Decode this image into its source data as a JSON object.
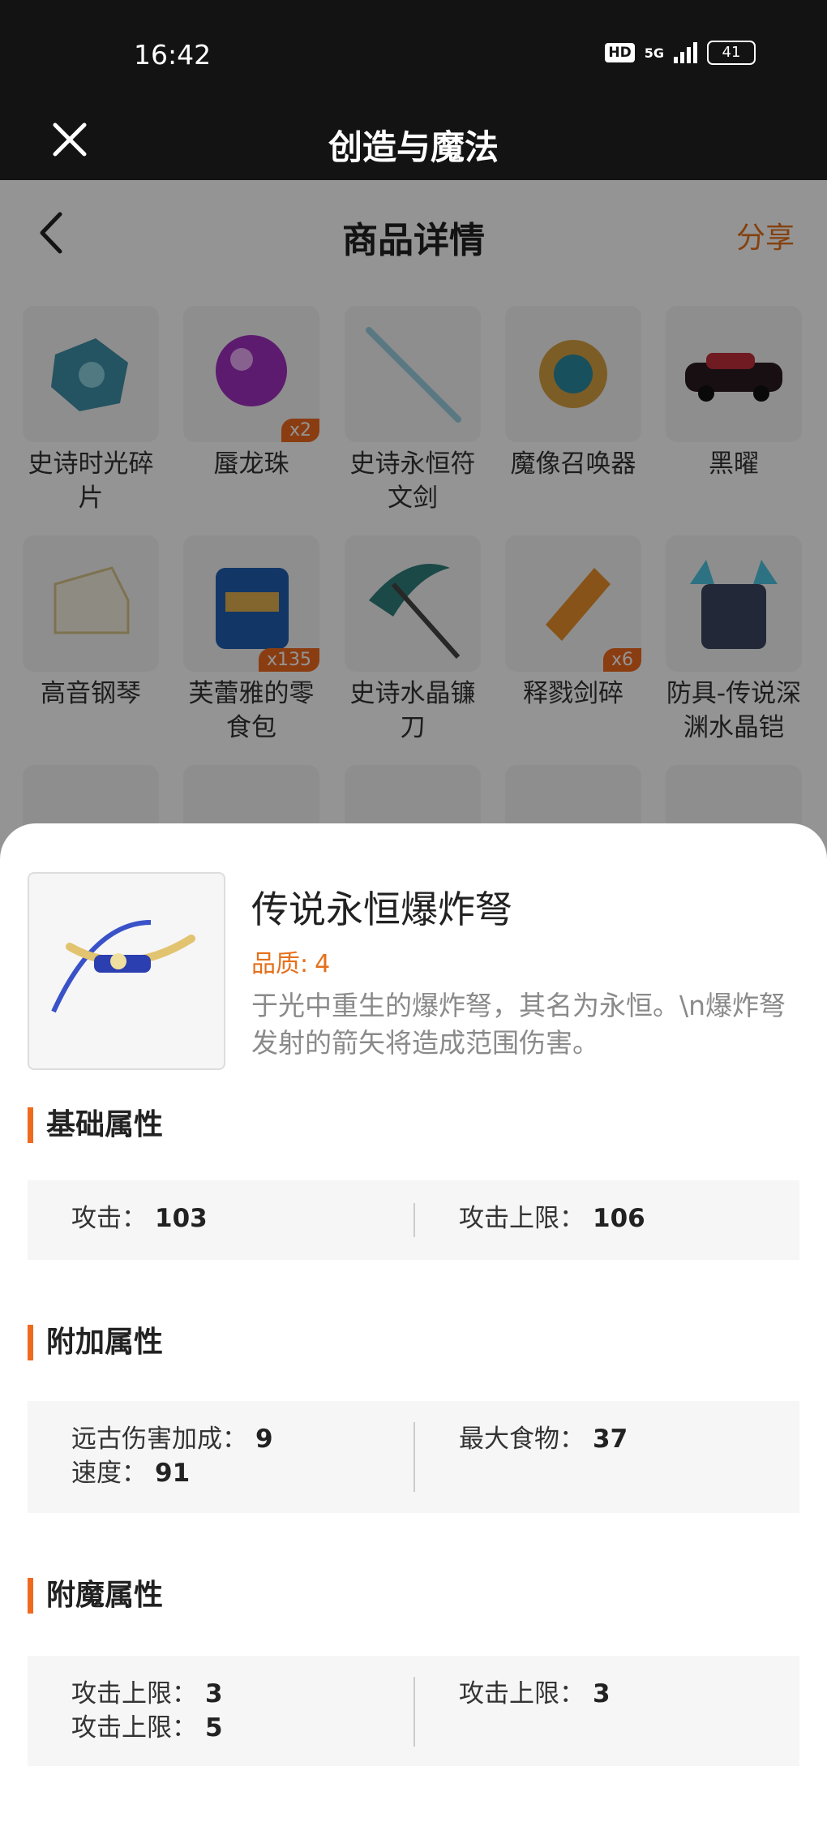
{
  "status": {
    "time": "16:42",
    "hd": "HD",
    "net": "5G",
    "battery": "41"
  },
  "titlebar": {
    "title": "创造与魔法"
  },
  "nav": {
    "title": "商品详情",
    "share": "分享"
  },
  "grid": [
    {
      "label": "史诗时光碎片",
      "badge": ""
    },
    {
      "label": "蜃龙珠",
      "badge": "x2"
    },
    {
      "label": "史诗永恒符文剑",
      "badge": ""
    },
    {
      "label": "魔像召唤器",
      "badge": ""
    },
    {
      "label": "黑曜",
      "badge": ""
    },
    {
      "label": "高音钢琴",
      "badge": ""
    },
    {
      "label": "芙蕾雅的零食包",
      "badge": "x135"
    },
    {
      "label": "史诗水晶镰刀",
      "badge": ""
    },
    {
      "label": "释戮剑碎",
      "badge": "x6"
    },
    {
      "label": "防具-传说深渊水晶铠",
      "badge": ""
    }
  ],
  "item": {
    "name": "传说永恒爆炸弩",
    "quality_label": "品质:",
    "quality_value": "4",
    "description": "于光中重生的爆炸弩，其名为永恒。\\n爆炸弩发射的箭矢将造成范围伤害。"
  },
  "basic": {
    "title": "基础属性",
    "left": [
      {
        "label": "攻击：",
        "value": "103"
      }
    ],
    "right": [
      {
        "label": "攻击上限：",
        "value": "106"
      }
    ]
  },
  "extra": {
    "title": "附加属性",
    "left": [
      {
        "label": "远古伤害加成：",
        "value": "9"
      },
      {
        "label": "速度：",
        "value": "91"
      }
    ],
    "right": [
      {
        "label": "最大食物：",
        "value": "37"
      }
    ]
  },
  "enchant": {
    "title": "附魔属性",
    "left": [
      {
        "label": "攻击上限：",
        "value": "3"
      },
      {
        "label": "攻击上限：",
        "value": "5"
      }
    ],
    "right": [
      {
        "label": "攻击上限：",
        "value": "3"
      }
    ]
  },
  "colors": {
    "accent": "#ef6a1f",
    "dark": "#131313"
  }
}
